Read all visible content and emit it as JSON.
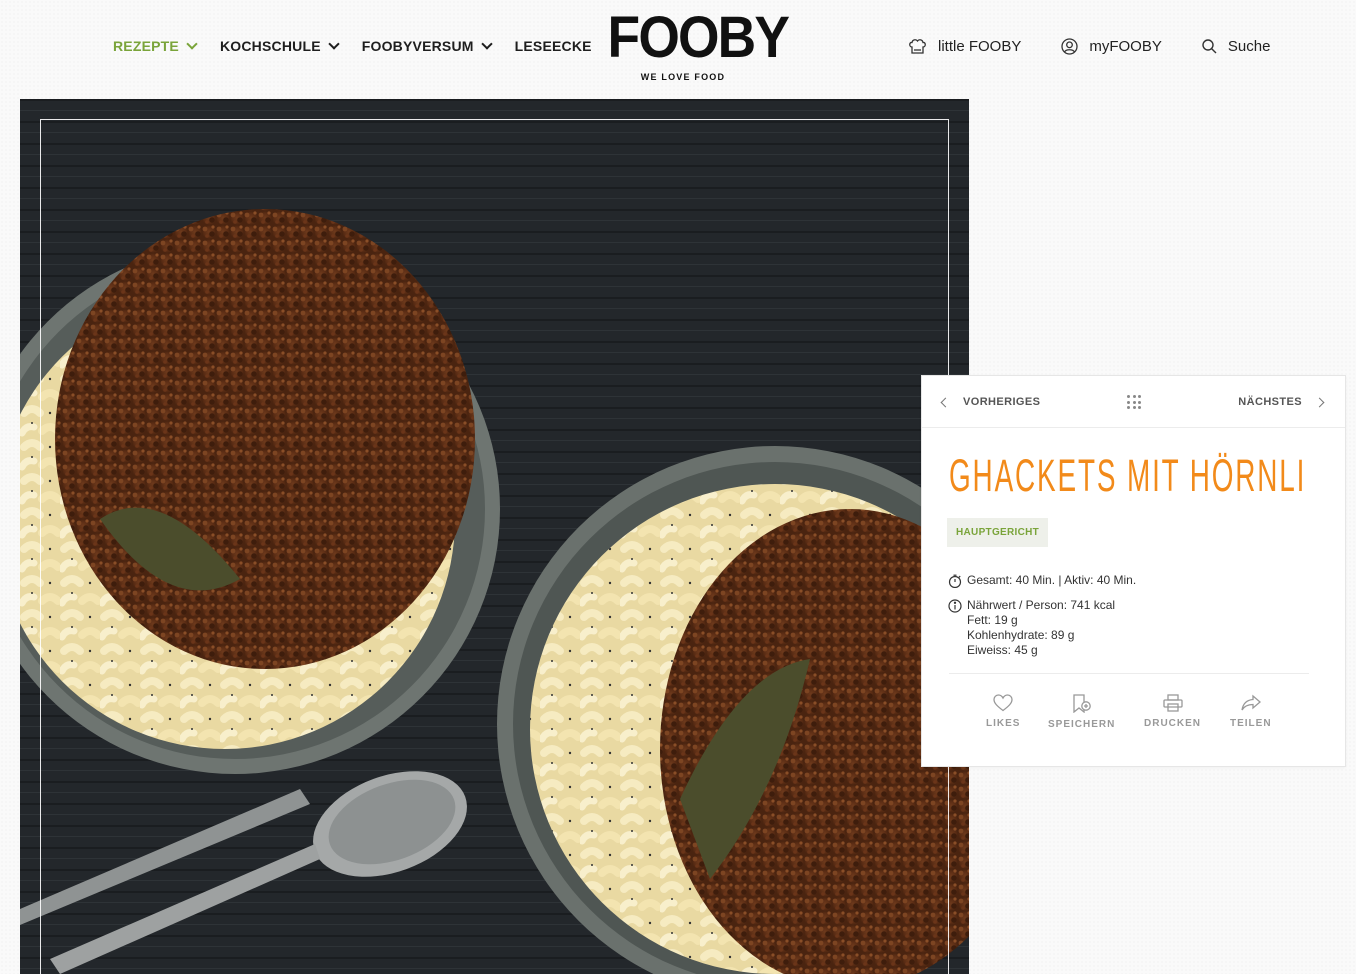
{
  "header": {
    "nav": [
      {
        "label": "REZEPTE",
        "active": true,
        "has_dropdown": true
      },
      {
        "label": "KOCHSCHULE",
        "active": false,
        "has_dropdown": true
      },
      {
        "label": "FOOBYVERSUM",
        "active": false,
        "has_dropdown": true
      },
      {
        "label": "LESEECKE",
        "active": false,
        "has_dropdown": false
      }
    ],
    "logo": {
      "word": "FOOBY",
      "tagline": "WE LOVE FOOD"
    },
    "meta": [
      {
        "label": "little FOOBY",
        "icon": "chef-hat-icon"
      },
      {
        "label": "myFOOBY",
        "icon": "user-icon"
      },
      {
        "label": "Suche",
        "icon": "search-icon"
      }
    ]
  },
  "hero": {
    "alt_subject": "two bowls of pasta with minced meat sauce",
    "icon": "hero-image"
  },
  "recipe": {
    "prev_label": "VORHERIGES",
    "next_label": "NÄCHSTES",
    "title": "GHACKETS MIT HÖRNLI",
    "category": "HAUPTGERICHT",
    "time": "Gesamt: 40 Min. | Aktiv: 40 Min.",
    "nutrition": {
      "headline": "Nährwert / Person: 741 kcal",
      "fat": "Fett: 19 g",
      "carbs": "Kohlenhydrate: 89 g",
      "protein": "Eiweiss: 45 g"
    },
    "actions": [
      {
        "label": "LIKES",
        "icon": "heart-icon"
      },
      {
        "label": "SPEICHERN",
        "icon": "bookmark-icon"
      },
      {
        "label": "DRUCKEN",
        "icon": "printer-icon"
      },
      {
        "label": "TEILEN",
        "icon": "share-icon"
      }
    ]
  },
  "colors": {
    "accent_green": "#7aa43a",
    "title_orange": "#f28a1a"
  }
}
